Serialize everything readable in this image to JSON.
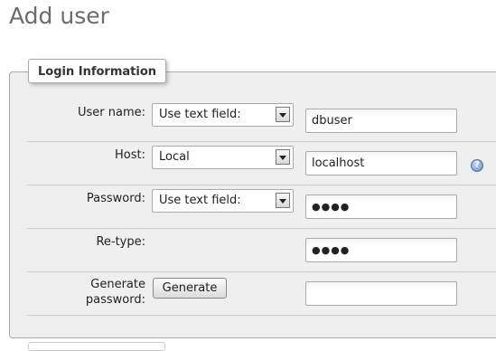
{
  "page": {
    "title": "Add user"
  },
  "fieldset": {
    "legend": "Login Information"
  },
  "rows": {
    "username": {
      "label": "User name:",
      "select_value": "Use text field:",
      "input_value": "dbuser"
    },
    "host": {
      "label": "Host:",
      "select_value": "Local",
      "input_value": "localhost",
      "help_icon": "help-icon"
    },
    "password": {
      "label": "Password:",
      "select_value": "Use text field:",
      "input_value": "●●●●"
    },
    "retype": {
      "label": "Re-type:",
      "input_value": "●●●●"
    },
    "generate": {
      "label_line1": "Generate",
      "label_line2": "password:",
      "button_label": "Generate",
      "input_value": ""
    }
  },
  "help": {
    "glyph": "?"
  },
  "colors": {
    "fieldset_bg": "#efefef",
    "border": "#aaaaaa",
    "title": "#6b6b6b"
  }
}
